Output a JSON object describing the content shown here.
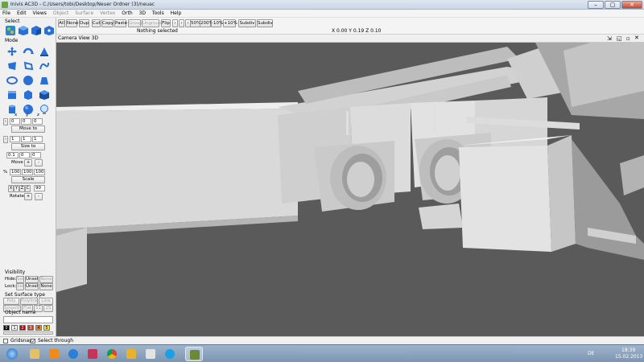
{
  "window": {
    "title": "Inivis AC3D - C:/Users/tobi/Desktop/Neuer Ordner (3)/neuac",
    "controls": {
      "minimize": "–",
      "maximize": "▢",
      "close": "✕"
    }
  },
  "menu": [
    {
      "label": "File"
    },
    {
      "label": "Edit"
    },
    {
      "label": "Views"
    },
    {
      "label": "Object",
      "disabled": true
    },
    {
      "label": "Surface",
      "disabled": true
    },
    {
      "label": "Vertex",
      "disabled": true
    },
    {
      "label": "Orth"
    },
    {
      "label": "3D"
    },
    {
      "label": "Tools"
    },
    {
      "label": "Help"
    }
  ],
  "left_panel": {
    "select_label": "Select",
    "mode_label": "Mode",
    "axis_labels": [
      "x",
      "y",
      "z"
    ],
    "position_values": [
      "0",
      "0",
      "0"
    ],
    "move_to_label": "Move to",
    "size_values": [
      "1",
      "1",
      "1"
    ],
    "size_to_label": "Size to",
    "move_values": [
      "0.1",
      "0",
      "0"
    ],
    "move_label": "Move",
    "plus": "+",
    "minus": "-",
    "scale_values": [
      "100",
      "100",
      "100"
    ],
    "percent": "%",
    "scale_label": "Scale",
    "rotate_axes": [
      "X",
      "Y",
      "Z",
      "C"
    ],
    "rotate_value": "90",
    "rotate_label": "Rotate",
    "visibility_label": "Visibility",
    "hide_label": "Hide:",
    "lock_label": "Lock:",
    "sel_label": "Sel",
    "unsel_label": "Unsel",
    "none_label": "None",
    "surface_type_label": "Set Surface type",
    "surface_buttons": [
      "Poly",
      "Polyline",
      "Line",
      "Smooth",
      "Flat",
      "S1",
      "2S"
    ],
    "object_name_label": "Object name",
    "color_indices": [
      "0",
      "1",
      "2",
      "3",
      "4",
      "5"
    ]
  },
  "toolbar": {
    "buttons": [
      "All",
      "None",
      "Dup",
      "Cut",
      "Copy",
      "Paste",
      "Group",
      "Ungroup",
      "Flip"
    ],
    "disabled": [
      "Group",
      "Ungroup"
    ],
    "zoom_buttons": [
      "50%",
      "200%",
      "-10%",
      "+10%"
    ],
    "subdiv_plus": "Subdiv +",
    "subdiv_minus": "Subdiv -",
    "status": "Nothing selected",
    "coords": "X 0.00 Y 0.19 Z 0.10"
  },
  "viewport": {
    "label": "Camera View 3D"
  },
  "bottom": {
    "gridsnap": "Gridsnap",
    "select_through": "Select through"
  },
  "taskbar": {
    "lang": "DE",
    "time": "18:39",
    "date": "15.02.2013"
  },
  "colors": {
    "viewport_bg": "#5a5a5a",
    "model_light": "#d8d8d8",
    "model_mid": "#bcbcbc",
    "model_dark": "#9a9a9a",
    "accent_blue": "#2a6fd6"
  }
}
